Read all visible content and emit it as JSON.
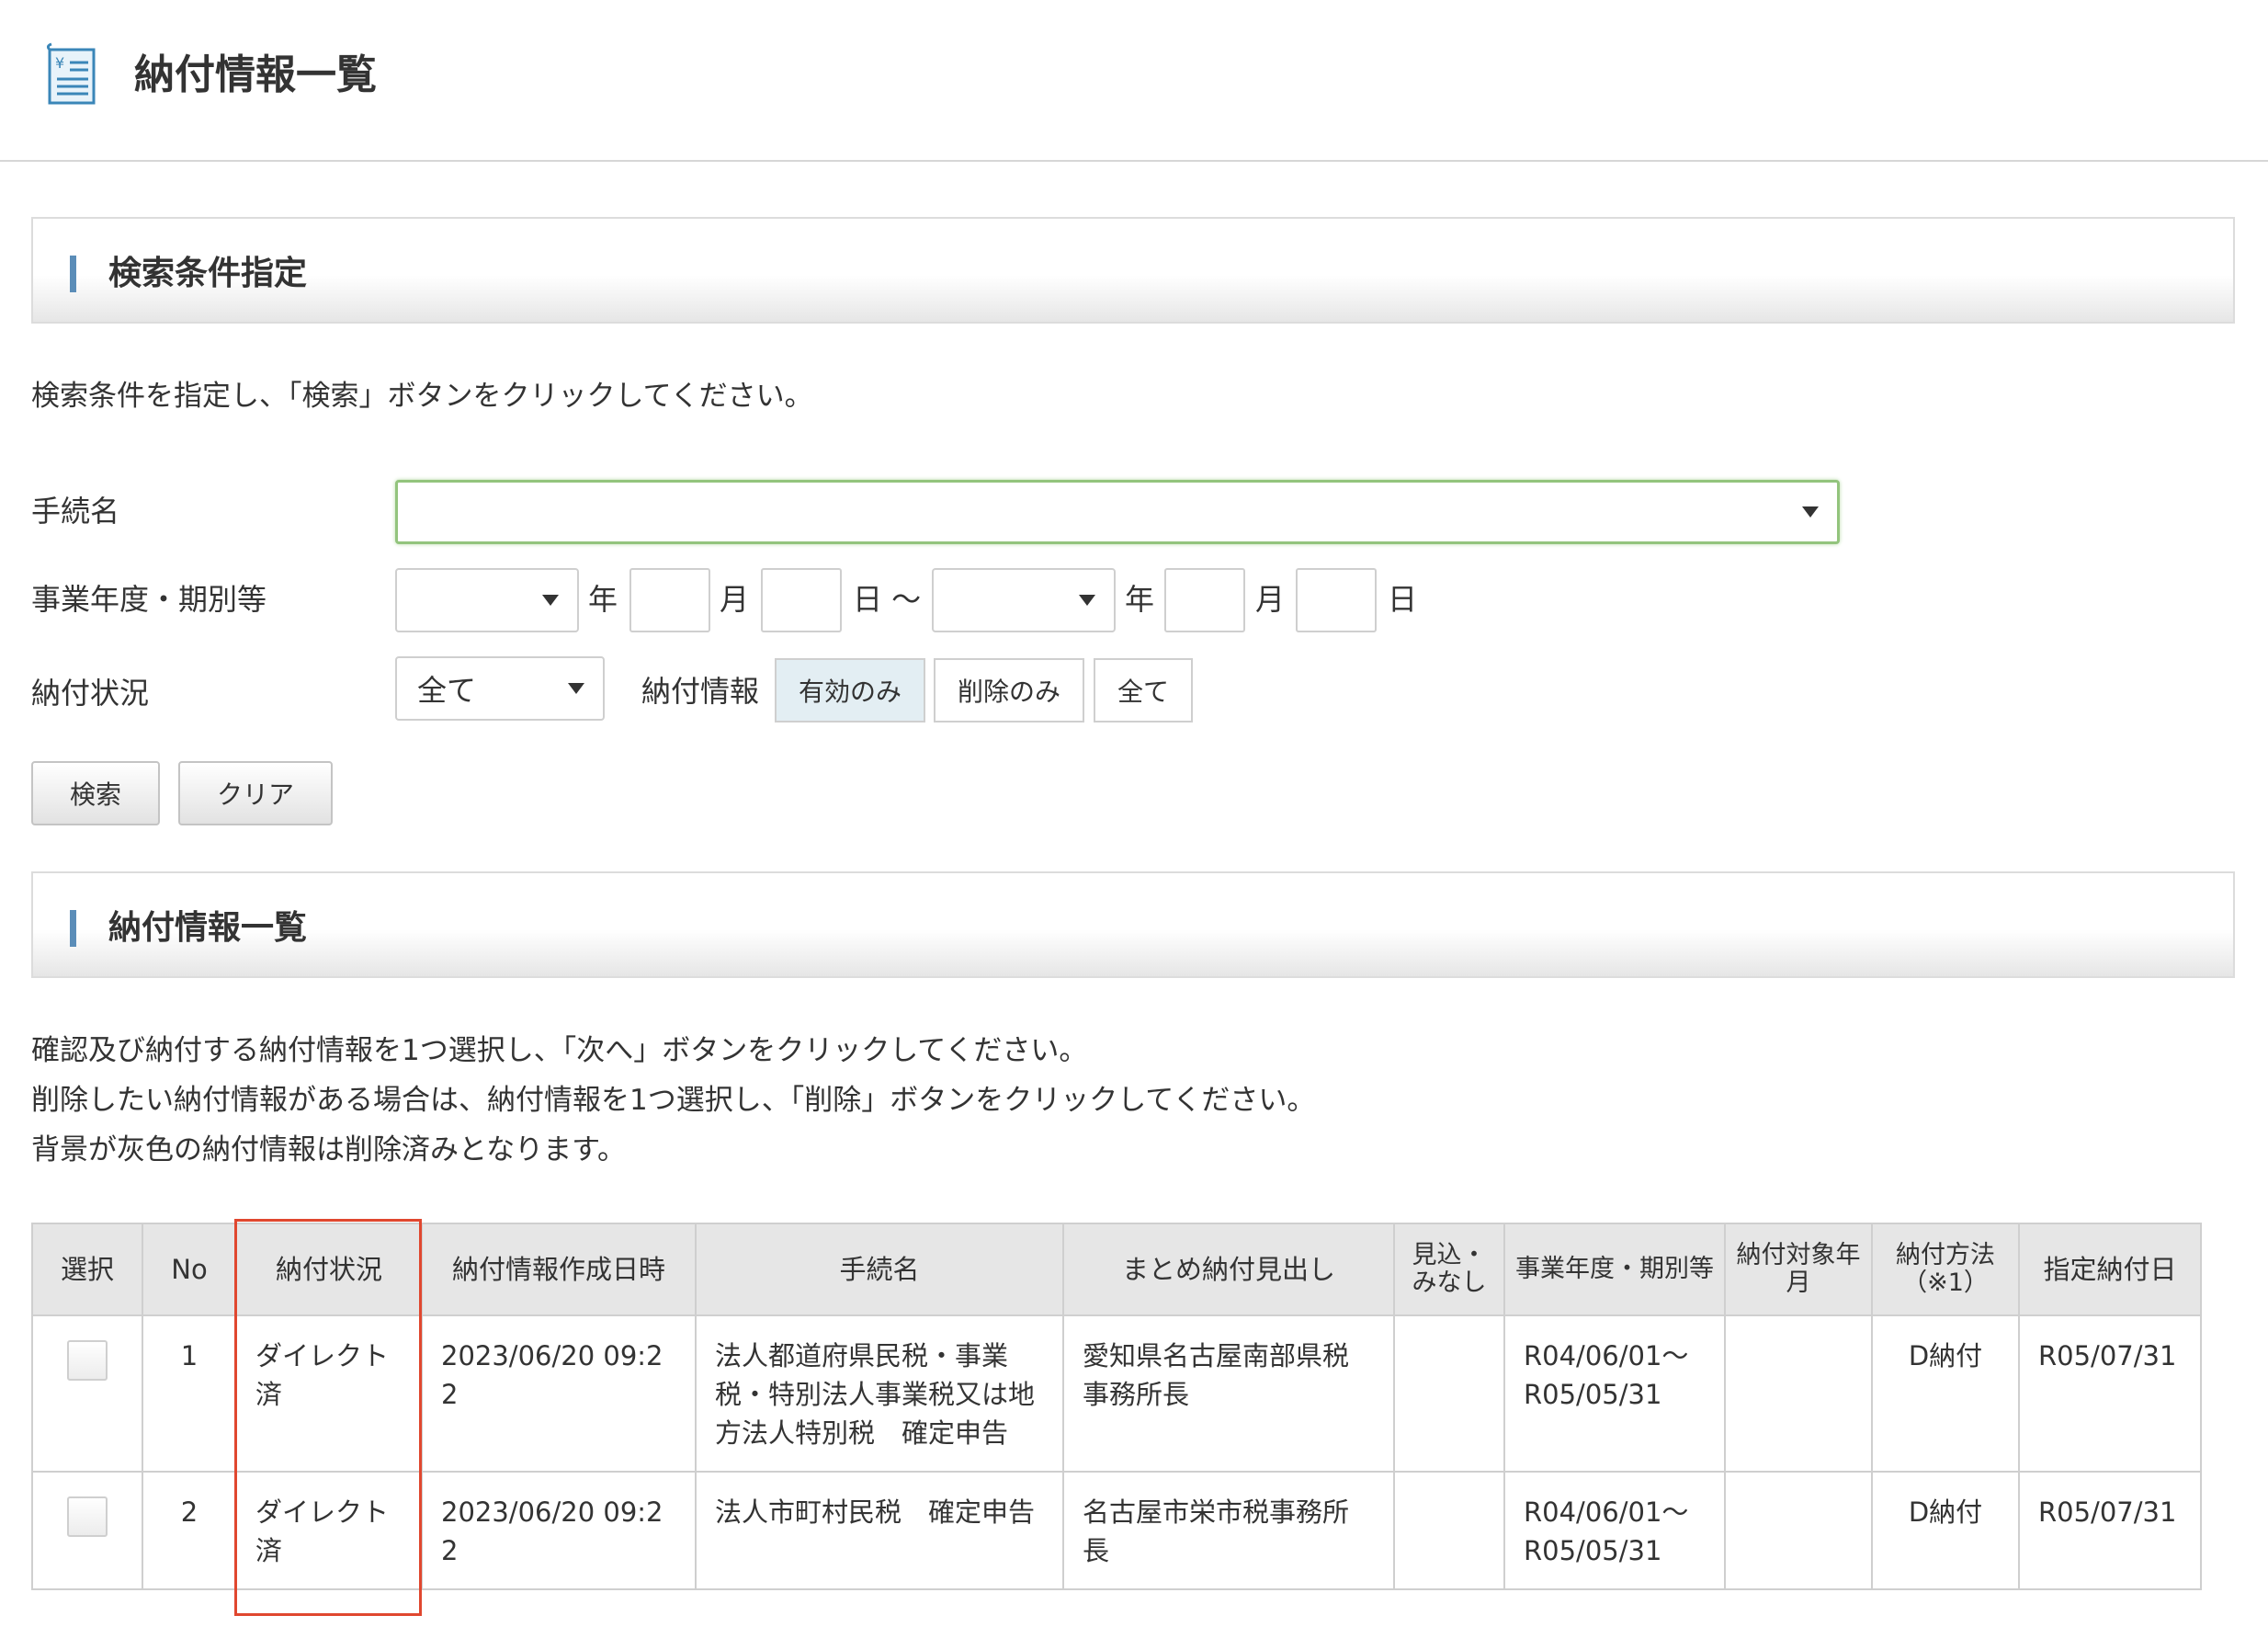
{
  "page": {
    "title": "納付情報一覧"
  },
  "search_section": {
    "title": "検索条件指定",
    "description": "検索条件を指定し、「検索」ボタンをクリックしてください。",
    "procedure_label": "手続名",
    "procedure_value": "",
    "period_label": "事業年度・期別等",
    "period_from_era": "",
    "period_to_era": "",
    "unit_year": "年",
    "unit_month": "月",
    "unit_day_from": "日 〜",
    "unit_day": "日",
    "status_label": "納付状況",
    "status_value": "全て",
    "info_label": "納付情報",
    "info_options": [
      "有効のみ",
      "削除のみ",
      "全て"
    ],
    "info_selected": "有効のみ",
    "search_button": "検索",
    "clear_button": "クリア"
  },
  "list_section": {
    "title": "納付情報一覧",
    "description_lines": [
      "確認及び納付する納付情報を1つ選択し、「次へ」ボタンをクリックしてください。",
      "削除したい納付情報がある場合は、納付情報を1つ選択し、「削除」ボタンをクリックしてください。",
      "背景が灰色の納付情報は削除済みとなります。"
    ]
  },
  "table": {
    "headers": {
      "select": "選択",
      "no": "No",
      "status": "納付状況",
      "created": "納付情報作成日時",
      "procedure": "手続名",
      "summary": "まとめ納付見出し",
      "estimate": "見込・みなし",
      "period": "事業年度・期別等",
      "target_month": "納付対象年月",
      "method": "納付方法（※1）",
      "due": "指定納付日"
    },
    "rows": [
      {
        "no": "1",
        "status": "ダイレクト済",
        "created": "2023/06/20 09:22",
        "procedure": "法人都道府県民税・事業税・特別法人事業税又は地方法人特別税　確定申告",
        "summary": "愛知県名古屋南部県税事務所長",
        "estimate": "",
        "period": "R04/06/01〜R05/05/31",
        "target_month": "",
        "method": "D納付",
        "due": "R05/07/31"
      },
      {
        "no": "2",
        "status": "ダイレクト済",
        "created": "2023/06/20 09:22",
        "procedure": "法人市町村民税　確定申告",
        "summary": "名古屋市栄市税事務所長",
        "estimate": "",
        "period": "R04/06/01〜R05/05/31",
        "target_month": "",
        "method": "D納付",
        "due": "R05/07/31"
      }
    ]
  },
  "colors": {
    "accent": "#5b8db8",
    "highlight": "#e0472f",
    "select_focus": "#93c47d"
  }
}
